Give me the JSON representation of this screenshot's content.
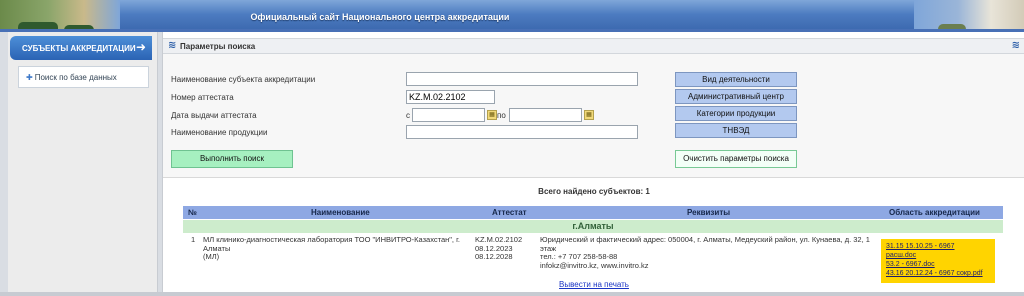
{
  "header": {
    "title": "Официальный сайт Национального центра аккредитации"
  },
  "sidebar": {
    "heading": "СУБЪЕКТЫ АККРЕДИТАЦИИ",
    "link": "Поиск по базе данных"
  },
  "panel": {
    "title": "Параметры поиска"
  },
  "form": {
    "subject_name_label": "Наименование субъекта аккредитации",
    "subject_name_value": "",
    "certificate_label": "Номер аттестата",
    "certificate_value": "KZ.M.02.2102",
    "issue_date_label": "Дата выдачи аттестата",
    "from_label": "с",
    "to_label": "по",
    "date_from_value": "",
    "date_to_value": "",
    "product_label": "Наименование продукции",
    "product_value": ""
  },
  "filters": {
    "activity": "Вид деятельности",
    "admin_center": "Административный центр",
    "product_categories": "Категории продукции",
    "tnved": "ТНВЭД"
  },
  "actions": {
    "search": "Выполнить поиск",
    "clear": "Очистить параметры поиска"
  },
  "results": {
    "found_label": "Всего найдено субъектов: 1",
    "columns": [
      "№",
      "Наименование",
      "Аттестат",
      "Реквизиты",
      "Область аккредитации"
    ],
    "city": "г.Алматы",
    "rows": [
      {
        "num": "1",
        "name_line1": "МЛ клинико-диагностическая лаборатория ТОО \"ИНВИТРО-Казахстан\", г.",
        "name_line2": "Алматы",
        "name_line3": "(МЛ)",
        "cert_number": "KZ.M.02.2102",
        "cert_issued": "08.12.2023",
        "cert_expires": "08.12.2028",
        "req_line1": "Юридический и фактический адрес: 050004, г. Алматы, Медеуский район, ул. Кунаева, д. 32, 1",
        "req_line2": "этаж",
        "req_line3": "тел.: +7 707 258-58-88",
        "req_line4": "infokz@invitro.kz, www.invitro.kz",
        "files": [
          "31.15 15.10.25 - 6967",
          "расш.doc",
          "53.2 - 6967.doc",
          "43.16 20.12.24 - 6967 сокр.pdf"
        ]
      }
    ]
  },
  "footer": {
    "print_link": "Вывести на печать"
  }
}
